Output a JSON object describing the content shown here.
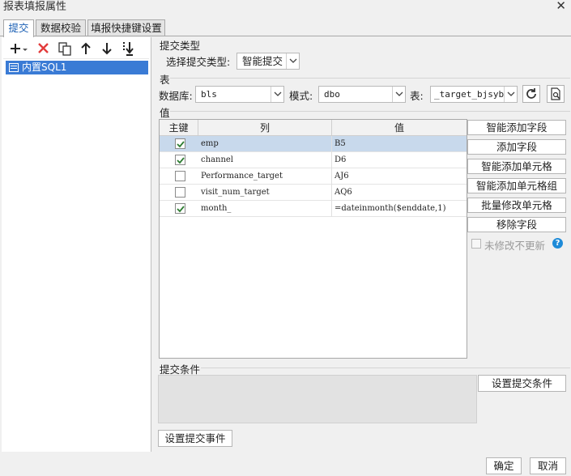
{
  "window": {
    "title": "报表填报属性",
    "close_glyph": "✕"
  },
  "tabs": [
    {
      "label": "提交",
      "active": true
    },
    {
      "label": "数据校验",
      "active": false
    },
    {
      "label": "填报快捷键设置",
      "active": false
    }
  ],
  "toolbar": {
    "icons": [
      "add-dropdown-icon",
      "delete-icon",
      "copy-icon",
      "move-up-icon",
      "move-down-icon",
      "move-bottom-icon"
    ]
  },
  "tree": {
    "items": [
      {
        "label": "内置SQL1",
        "selected": true
      }
    ]
  },
  "submit_type": {
    "section": "提交类型",
    "label": "选择提交类型:",
    "value": "智能提交"
  },
  "table_section": {
    "section": "表",
    "db_label": "数据库:",
    "db_value": "bls",
    "schema_label": "模式:",
    "schema_value": "dbo",
    "table_label": "表:",
    "table_value": "_target_bjsyb"
  },
  "value_section": {
    "section": "值",
    "headers": {
      "key": "主键",
      "column": "列",
      "value": "值"
    },
    "rows": [
      {
        "key": true,
        "column": "emp",
        "value": "B5",
        "selected": true
      },
      {
        "key": true,
        "column": "channel",
        "value": "D6",
        "selected": false
      },
      {
        "key": false,
        "column": "Performance_target",
        "value": "AJ6",
        "selected": false
      },
      {
        "key": false,
        "column": "visit_num_target",
        "value": "AQ6",
        "selected": false
      },
      {
        "key": true,
        "column": "month_",
        "value": "=dateinmonth($enddate,1)",
        "selected": false
      }
    ]
  },
  "side_buttons": {
    "smart_add_field": "智能添加字段",
    "add_field": "添加字段",
    "smart_add_cell": "智能添加单元格",
    "smart_add_cell_group": "智能添加单元格组",
    "batch_modify_cell": "批量修改单元格",
    "remove_field": "移除字段",
    "no_update_label": "未修改不更新",
    "help_glyph": "?"
  },
  "condition": {
    "section": "提交条件",
    "set_button": "设置提交条件"
  },
  "event_button": "设置提交事件",
  "footer": {
    "ok": "确定",
    "cancel": "取消"
  },
  "colors": {
    "accent": "#1a5fb4",
    "selected_tree": "#3a7bd5",
    "selected_row": "#c8d9ec",
    "delete": "#e23b3b",
    "help": "#1e8bd8",
    "check": "#2e7d32"
  }
}
